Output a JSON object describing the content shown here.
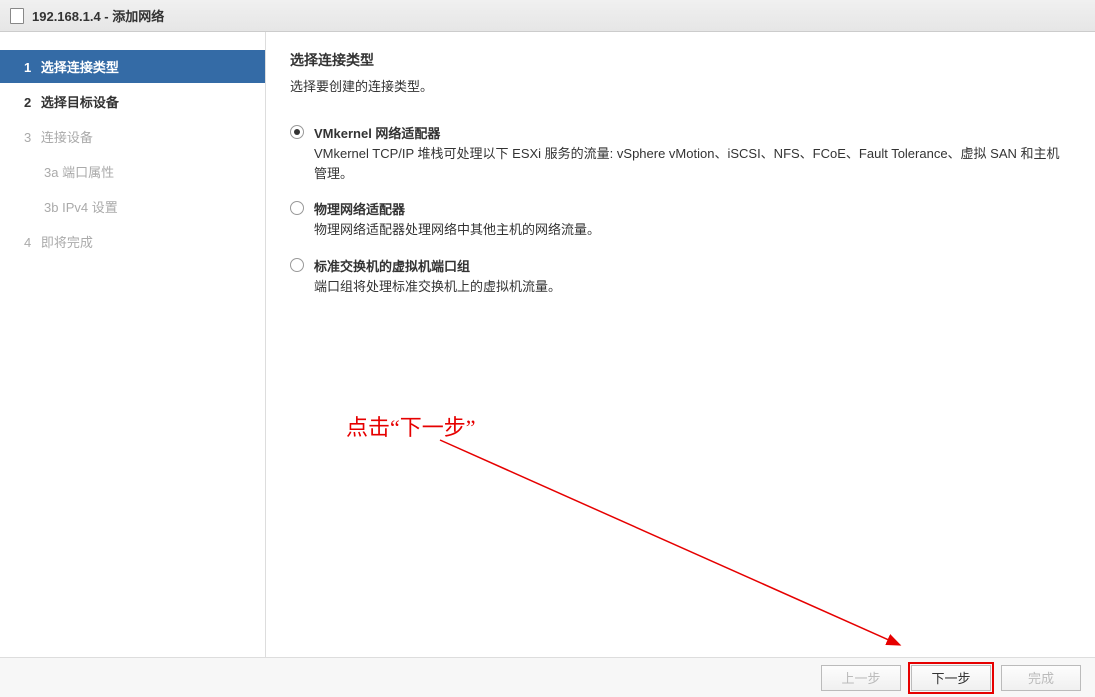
{
  "title": "192.168.1.4 - 添加网络",
  "sidebar": {
    "steps": [
      {
        "num": "1",
        "label": "选择连接类型"
      },
      {
        "num": "2",
        "label": "选择目标设备"
      },
      {
        "num": "3",
        "label": "连接设备"
      },
      {
        "num": "3a",
        "label": "端口属性"
      },
      {
        "num": "3b",
        "label": "IPv4 设置"
      },
      {
        "num": "4",
        "label": "即将完成"
      }
    ]
  },
  "content": {
    "title": "选择连接类型",
    "subtitle": "选择要创建的连接类型。",
    "options": [
      {
        "title": "VMkernel 网络适配器",
        "desc": "VMkernel TCP/IP 堆栈可处理以下 ESXi 服务的流量: vSphere vMotion、iSCSI、NFS、FCoE、Fault Tolerance、虚拟 SAN 和主机管理。"
      },
      {
        "title": "物理网络适配器",
        "desc": "物理网络适配器处理网络中其他主机的网络流量。"
      },
      {
        "title": "标准交换机的虚拟机端口组",
        "desc": "端口组将处理标准交换机上的虚拟机流量。"
      }
    ]
  },
  "footer": {
    "back": "上一步",
    "next": "下一步",
    "finish": "完成"
  },
  "annotation": {
    "text": "点击“下一步”"
  }
}
